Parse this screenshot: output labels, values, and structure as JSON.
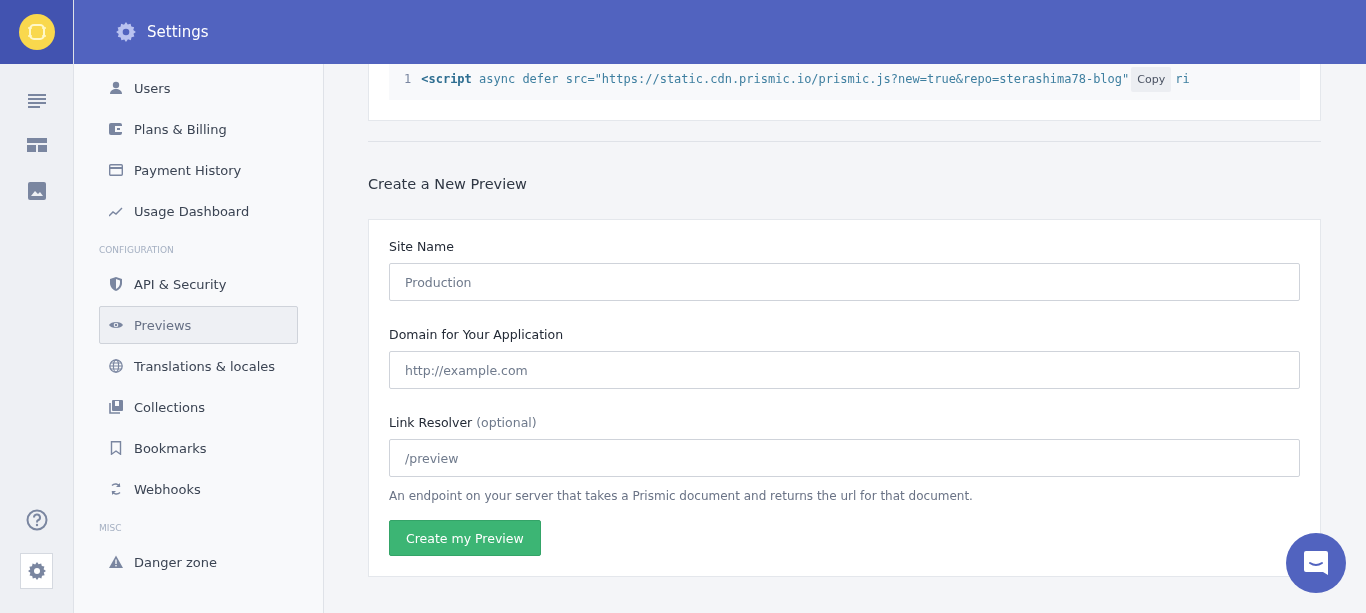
{
  "header": {
    "title": "Settings"
  },
  "nav": [
    {
      "kind": "item",
      "label": "Users",
      "selected": false
    },
    {
      "kind": "item",
      "label": "Plans & Billing",
      "selected": false
    },
    {
      "kind": "item",
      "label": "Payment History",
      "selected": false
    },
    {
      "kind": "item",
      "label": "Usage Dashboard",
      "selected": false
    },
    {
      "kind": "section",
      "label": "CONFIGURATION"
    },
    {
      "kind": "item",
      "label": "API & Security",
      "selected": false
    },
    {
      "kind": "item",
      "label": "Previews",
      "selected": true
    },
    {
      "kind": "item",
      "label": "Translations & locales",
      "selected": false
    },
    {
      "kind": "item",
      "label": "Collections",
      "selected": false
    },
    {
      "kind": "item",
      "label": "Bookmarks",
      "selected": false
    },
    {
      "kind": "item",
      "label": "Webhooks",
      "selected": false
    },
    {
      "kind": "section",
      "label": "MISC"
    },
    {
      "kind": "item",
      "label": "Danger zone",
      "selected": false
    }
  ],
  "code": {
    "line_number": "1",
    "tag": "<script",
    "rest": " async defer src=\"https://static.cdn.prismic.io/prismic.js?new=true&repo=sterashima78-blog\"",
    "copy": "Copy",
    "tail": "ri"
  },
  "section_title": "Create a New Preview",
  "form": {
    "fields": [
      {
        "label": "Site Name",
        "placeholder": "Production"
      },
      {
        "label": "Domain for Your Application",
        "placeholder": "http://example.com"
      },
      {
        "label": "Link Resolver",
        "note": "(optional)",
        "placeholder": "/preview"
      }
    ],
    "help": "An endpoint on your server that takes a Prismic document and returns the url for that document.",
    "submit": "Create my Preview"
  }
}
